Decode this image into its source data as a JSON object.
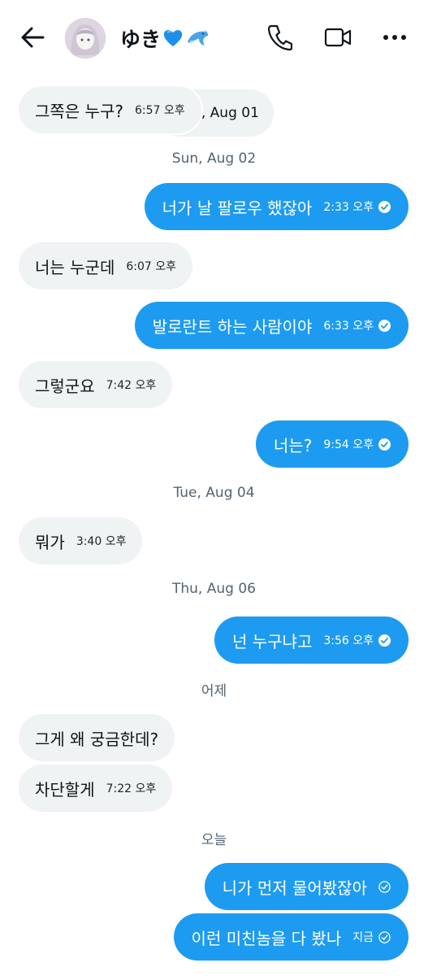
{
  "header": {
    "contact_name": "ゆき",
    "back_icon": "arrow-left-icon",
    "call_icon": "phone-icon",
    "video_icon": "video-camera-icon",
    "more_icon": "more-horizontal-icon",
    "name_emojis": [
      "blue-heart-icon",
      "dolphin-icon"
    ]
  },
  "colors": {
    "outgoing_bubble": "#1d9bf0",
    "incoming_bubble": "#eff3f4",
    "date_text": "#536471"
  },
  "messages": [
    {
      "dir": "in",
      "text": "그쪽은 누구?",
      "time": "6:57 오후"
    },
    {
      "type": "date",
      "text": "Sat, Aug 01"
    },
    {
      "type": "date",
      "text": "Sun, Aug 02"
    },
    {
      "dir": "out",
      "text": "너가 날 팔로우 했잖아",
      "time": "2:33 오후",
      "status": "read"
    },
    {
      "dir": "in",
      "text": "너는 누군데",
      "time": "6:07 오후"
    },
    {
      "dir": "out",
      "text": "발로란트 하는 사람이야",
      "time": "6:33 오후",
      "status": "read"
    },
    {
      "dir": "in",
      "text": "그렇군요",
      "time": "7:42 오후"
    },
    {
      "dir": "out",
      "text": "너는?",
      "time": "9:54 오후",
      "status": "read"
    },
    {
      "type": "date",
      "text": "Tue, Aug 04"
    },
    {
      "dir": "in",
      "text": "뭐가",
      "time": "3:40 오후"
    },
    {
      "type": "date",
      "text": "Thu, Aug 06"
    },
    {
      "dir": "out",
      "text": "넌 누구냐고",
      "time": "3:56 오후",
      "status": "read"
    },
    {
      "type": "date",
      "text": "어제"
    },
    {
      "dir": "in",
      "text": "그게 왜 궁금한데?",
      "time": ""
    },
    {
      "dir": "in",
      "text": "차단할게",
      "time": "7:22 오후"
    },
    {
      "type": "date",
      "text": "오늘"
    },
    {
      "dir": "out",
      "text": "니가 먼저 물어봤잖아",
      "time": "",
      "status": "sent"
    },
    {
      "dir": "out",
      "text": "이런 미친놈을 다 봤나",
      "time": "지금",
      "status": "sent"
    }
  ]
}
